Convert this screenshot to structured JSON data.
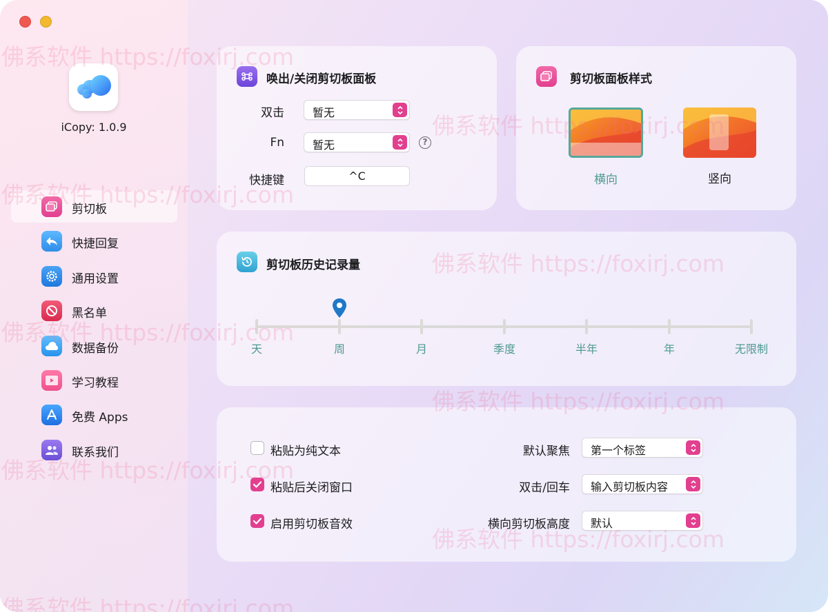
{
  "app": {
    "name_version": "iCopy: 1.0.9"
  },
  "sidebar": {
    "items": [
      {
        "label": "剪切板",
        "icon": "clipboard-icon",
        "color": "#e84a9a",
        "active": true
      },
      {
        "label": "快捷回复",
        "icon": "reply-icon",
        "color": "#3a9bf0",
        "active": false
      },
      {
        "label": "通用设置",
        "icon": "gear-icon",
        "color": "#2f8ee8",
        "active": false
      },
      {
        "label": "黑名单",
        "icon": "block-icon",
        "color": "#e8365a",
        "active": false
      },
      {
        "label": "数据备份",
        "icon": "cloud-icon",
        "color": "#3aa6f2",
        "active": false
      },
      {
        "label": "学习教程",
        "icon": "video-icon",
        "color": "#f0508c",
        "active": false
      },
      {
        "label": "免费 Apps",
        "icon": "appstore-icon",
        "color": "#2f7fe8",
        "active": false
      },
      {
        "label": "联系我们",
        "icon": "contacts-icon",
        "color": "#7a5ae0",
        "active": false
      }
    ]
  },
  "hotkey_card": {
    "title": "唤出/关闭剪切板面板",
    "double_click_label": "双击",
    "double_click_value": "暂无",
    "fn_label": "Fn",
    "fn_value": "暂无",
    "help_symbol": "?",
    "shortcut_label": "快捷键",
    "shortcut_value": "^C"
  },
  "style_card": {
    "title": "剪切板面板样式",
    "horizontal_label": "横向",
    "vertical_label": "竖向",
    "selected": "横向"
  },
  "history_card": {
    "title": "剪切板历史记录量",
    "ticks": [
      "天",
      "周",
      "月",
      "季度",
      "半年",
      "年",
      "无限制"
    ],
    "selected_index": 1
  },
  "options_card": {
    "checkboxes": [
      {
        "label": "粘贴为纯文本",
        "checked": false
      },
      {
        "label": "粘贴后关闭窗口",
        "checked": true
      },
      {
        "label": "启用剪切板音效",
        "checked": true
      }
    ],
    "selects": [
      {
        "label": "默认聚焦",
        "value": "第一个标签"
      },
      {
        "label": "双击/回车",
        "value": "输入剪切板内容"
      },
      {
        "label": "横向剪切板高度",
        "value": "默认"
      }
    ]
  },
  "watermark": "佛系软件 https://foxirj.com",
  "colors": {
    "accent": "#e23f8f",
    "tick_label": "#4d9a91",
    "selected_style_label": "#4d9a91"
  }
}
